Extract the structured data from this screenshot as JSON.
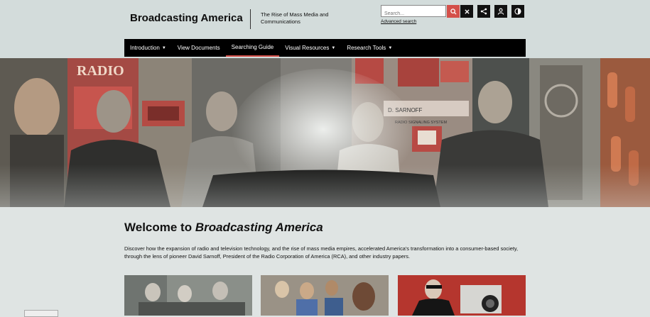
{
  "header": {
    "title": "Broadcasting America",
    "tagline": "The Rise of Mass Media and Communications"
  },
  "search": {
    "placeholder": "Search...",
    "advanced_label": "Advanced search"
  },
  "icons": {
    "search": "search-icon",
    "clear": "close-icon",
    "share": "share-icon",
    "account": "user-icon",
    "contrast": "contrast-icon"
  },
  "nav": {
    "items": [
      {
        "label": "Introduction",
        "has_dropdown": true
      },
      {
        "label": "View Documents",
        "has_dropdown": false
      },
      {
        "label": "Searching Guide",
        "has_dropdown": false,
        "active": true
      },
      {
        "label": "Visual Resources",
        "has_dropdown": true
      },
      {
        "label": "Research Tools",
        "has_dropdown": true
      }
    ]
  },
  "hero": {
    "sign_radio": "RADIO",
    "sign_sarnoff": "D. SARNOFF",
    "sign_system": "RADIO SIGNALING SYSTEM"
  },
  "welcome": {
    "title_prefix": "Welcome to ",
    "title_em": "Broadcasting America",
    "intro": "Discover how the expansion of radio and television technology, and the rise of mass media empires, accelerated America's transformation into a consumer-based society, through the lens of pioneer David Sarnoff, President of the Radio Corporation of America (RCA), and other industry papers."
  },
  "colors": {
    "accent": "#d4504a",
    "nav_bg": "#000000",
    "header_bg": "#d3dcdb",
    "page_bg": "#dfe4e3"
  }
}
